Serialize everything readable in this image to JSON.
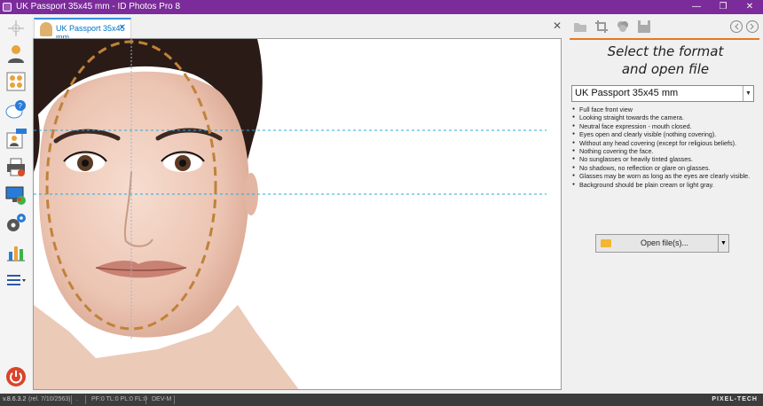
{
  "window": {
    "title": "UK Passport 35x45 mm - ID Photos Pro 8",
    "controls": {
      "minimize": "—",
      "restore": "❐",
      "close": "✕"
    }
  },
  "toolbar_left": {
    "items": [
      {
        "name": "portrait-tool-icon"
      },
      {
        "name": "group-photos-icon"
      },
      {
        "name": "help-icon"
      },
      {
        "name": "new-badge-icon"
      },
      {
        "name": "printer-icon"
      },
      {
        "name": "display-icon"
      },
      {
        "name": "settings-gears-icon"
      },
      {
        "name": "statistics-chart-icon"
      },
      {
        "name": "menu-icon"
      },
      {
        "name": "power-icon"
      }
    ]
  },
  "tabs": [
    {
      "label": "UK Passport 35x45 mm",
      "close": "✕"
    }
  ],
  "tabstrip_close": "✕",
  "colors": {
    "title_bar": "#7b2b9a",
    "accent_orange": "#e87722",
    "tab_accent": "#3a8ee6",
    "guide_line": "#29a8e0",
    "face_oval": "#c0823a",
    "status_bar": "#3c3c3c"
  },
  "right_panel": {
    "heading_line1": "Select the format",
    "heading_line2": "and open file",
    "format_selected": "UK Passport 35x45 mm",
    "requirements": [
      "Full face front view",
      "Looking straight towards the camera.",
      "Neutral face expression - mouth closed.",
      "Eyes open and clearly visible (nothing covering).",
      "Without any head covering (except for religious beliefs).",
      "Nothing covering the face.",
      "No sunglasses or heavily tinted glasses.",
      "No shadows, no reflection or glare on glasses.",
      "Glasses may be worn as long as the eyes are clearly visible.",
      "Background should be plain cream or light gray."
    ],
    "open_button_label": "Open file(s)..."
  },
  "status_bar": {
    "version": "v.8.6.3.2",
    "release": "(rel. 7/10/2563)",
    "dot": ".",
    "flags": "PF:0 TL:0 PL:0 FL:0",
    "mode": "DEV-M",
    "brand": "PIXEL-TECH"
  }
}
